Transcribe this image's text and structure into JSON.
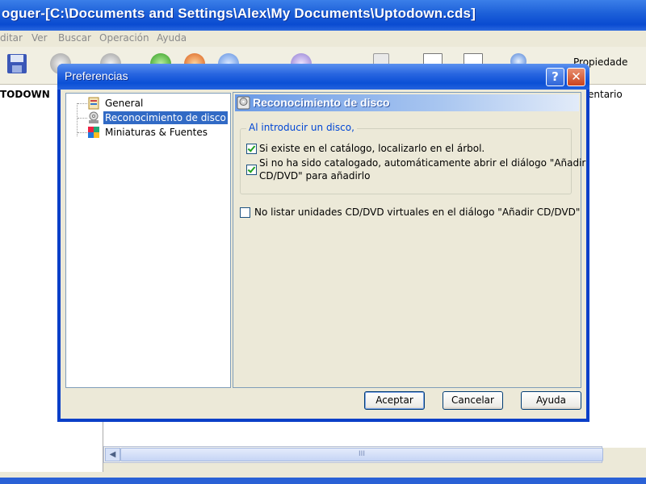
{
  "main": {
    "title": "oguer-[C:\\Documents and Settings\\Alex\\My Documents\\Uptodown.cds]",
    "menu": [
      "ditar",
      "Ver",
      "Buscar",
      "Operación",
      "Ayuda"
    ],
    "toolbar_properties": "Propiedade",
    "left_header": "TODOWN",
    "right_header": "entario",
    "scroll_thumb": "III"
  },
  "dialog": {
    "title": "Preferencias",
    "help_glyph": "?",
    "close_glyph": "✕",
    "tree": [
      {
        "label": "General",
        "icon": "general-icon",
        "selected": false
      },
      {
        "label": "Reconocimiento de disco",
        "icon": "disc-icon",
        "selected": true
      },
      {
        "label": "Miniaturas & Fuentes",
        "icon": "thumbnails-icon",
        "selected": false
      }
    ],
    "panel_title": "Reconocimiento de disco",
    "group_label": "Al introducir un disco,",
    "options": {
      "locate": {
        "label": "Si existe en el catálogo, localizarlo en el árbol.",
        "checked": true
      },
      "add_line1": "Si no ha sido catalogado, automáticamente abrir el diálogo \"Añadir",
      "add_line2": "CD/DVD\" para añadirlo",
      "add_checked": true,
      "virtual": {
        "label": "No listar unidades CD/DVD virtuales en el diálogo \"Añadir CD/DVD\"",
        "checked": false
      }
    },
    "buttons": {
      "accept": "Aceptar",
      "cancel": "Cancelar",
      "help": "Ayuda"
    }
  },
  "colors": {
    "title_blue": "#0a4bd1",
    "selection": "#316ac5",
    "group_label": "#0046d5",
    "check": "#21a121"
  }
}
